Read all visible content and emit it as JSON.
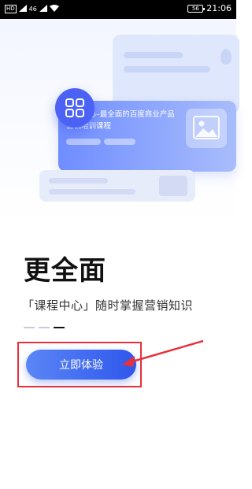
{
  "status_bar": {
    "sim1": "HD",
    "sim2": "46",
    "battery": "56",
    "time": "21:06"
  },
  "hero": {
    "card_text": "课程中心–最全面的百度商业产品营销培训课程"
  },
  "onboarding": {
    "headline": "更全面",
    "subtitle": "「课程中心」随时掌握营销知识",
    "page_indicator": {
      "total": 3,
      "active_index": 2
    },
    "cta_label": "立即体验"
  },
  "colors": {
    "accent": "#4b62f5",
    "button_start": "#5a86f6",
    "button_end": "#2f57ec",
    "highlight": "#e8303a"
  }
}
